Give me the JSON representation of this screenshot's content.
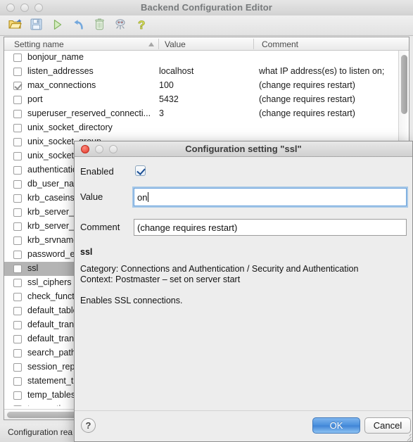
{
  "window": {
    "title": "Backend Configuration Editor",
    "traffic_lights": [
      "close",
      "minimize",
      "zoom"
    ],
    "toolbar": [
      {
        "name": "open-folder-icon",
        "label": "Open"
      },
      {
        "name": "save-disk-icon",
        "label": "Save"
      },
      {
        "name": "run-play-icon",
        "label": "Run"
      },
      {
        "name": "undo-arrow-icon",
        "label": "Undo"
      },
      {
        "name": "trash-icon",
        "label": "Delete"
      },
      {
        "name": "bug-icon",
        "label": "Debug"
      },
      {
        "name": "help-question-icon",
        "label": "Help"
      }
    ],
    "status": "Configuration rea"
  },
  "table": {
    "columns": [
      {
        "key": "name",
        "label": "Setting name",
        "sorted": "asc"
      },
      {
        "key": "value",
        "label": "Value"
      },
      {
        "key": "comment",
        "label": "Comment"
      }
    ],
    "rows": [
      {
        "checked": false,
        "selected": false,
        "name": "bonjour_name",
        "value": "",
        "comment": ""
      },
      {
        "checked": false,
        "selected": false,
        "name": "listen_addresses",
        "value": "localhost",
        "comment": "what IP address(es) to listen on;"
      },
      {
        "checked": true,
        "selected": false,
        "name": "max_connections",
        "value": "100",
        "comment": "(change requires restart)"
      },
      {
        "checked": false,
        "selected": false,
        "name": "port",
        "value": "5432",
        "comment": "(change requires restart)"
      },
      {
        "checked": false,
        "selected": false,
        "name": "superuser_reserved_connecti...",
        "value": "3",
        "comment": "(change requires restart)"
      },
      {
        "checked": false,
        "selected": false,
        "name": "unix_socket_directory",
        "value": "",
        "comment": ""
      },
      {
        "checked": false,
        "selected": false,
        "name": "unix_socket_group",
        "value": "",
        "comment": ""
      },
      {
        "checked": false,
        "selected": false,
        "name": "unix_socket_",
        "value": "",
        "comment": ""
      },
      {
        "checked": false,
        "selected": false,
        "name": "authenticatio",
        "value": "",
        "comment": ""
      },
      {
        "checked": false,
        "selected": false,
        "name": "db_user_nam",
        "value": "",
        "comment": ""
      },
      {
        "checked": false,
        "selected": false,
        "name": "krb_caseins",
        "value": "",
        "comment": ""
      },
      {
        "checked": false,
        "selected": false,
        "name": "krb_server_h",
        "value": "",
        "comment": ""
      },
      {
        "checked": false,
        "selected": false,
        "name": "krb_server_k",
        "value": "",
        "comment": ""
      },
      {
        "checked": false,
        "selected": false,
        "name": "krb_srvname",
        "value": "",
        "comment": ""
      },
      {
        "checked": false,
        "selected": false,
        "name": "password_er",
        "value": "",
        "comment": ""
      },
      {
        "checked": false,
        "selected": true,
        "name": "ssl",
        "value": "",
        "comment": ""
      },
      {
        "checked": false,
        "selected": false,
        "name": "ssl_ciphers",
        "value": "",
        "comment": ""
      },
      {
        "checked": false,
        "selected": false,
        "name": "check_functi",
        "value": "",
        "comment": ""
      },
      {
        "checked": false,
        "selected": false,
        "name": "default_table",
        "value": "",
        "comment": ""
      },
      {
        "checked": false,
        "selected": false,
        "name": "default_trans",
        "value": "",
        "comment": ""
      },
      {
        "checked": false,
        "selected": false,
        "name": "default_trans",
        "value": "",
        "comment": ""
      },
      {
        "checked": false,
        "selected": false,
        "name": "search_path",
        "value": "",
        "comment": ""
      },
      {
        "checked": false,
        "selected": false,
        "name": "session_repl",
        "value": "",
        "comment": ""
      },
      {
        "checked": false,
        "selected": false,
        "name": "statement_ti",
        "value": "",
        "comment": ""
      },
      {
        "checked": false,
        "selected": false,
        "name": "temp_tablesp",
        "value": "",
        "comment": ""
      },
      {
        "checked": false,
        "selected": false,
        "name": "transaction_i",
        "value": "",
        "comment": ""
      }
    ]
  },
  "dialog": {
    "title": "Configuration setting \"ssl\"",
    "enabled_label": "Enabled",
    "enabled_checked": true,
    "value_label": "Value",
    "value_text": "on",
    "comment_label": "Comment",
    "comment_text": "(change requires restart)",
    "setting_name": "ssl",
    "category_line": "Category: Connections and Authentication / Security and Authentication",
    "context_line": "Context: Postmaster – set on server start",
    "description": "Enables SSL connections.",
    "help_label": "?",
    "ok_label": "OK",
    "cancel_label": "Cancel"
  },
  "colors": {
    "accent_blue": "#4b90dd",
    "selection_gray": "#b4b4b4",
    "close_red": "#e0392b",
    "dialog_bg": "#ededed"
  }
}
